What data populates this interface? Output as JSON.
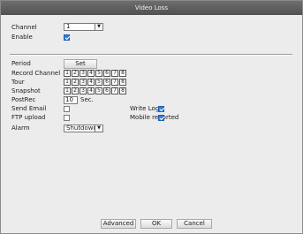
{
  "window": {
    "title": "Video Loss"
  },
  "channel": {
    "label": "Channel",
    "value": "1"
  },
  "enable": {
    "label": "Enable",
    "checked": true
  },
  "period": {
    "label": "Period",
    "button": "Set"
  },
  "record_channel": {
    "label": "Record Channel",
    "channels": [
      "1",
      "2",
      "3",
      "4",
      "5",
      "6",
      "7",
      "8"
    ]
  },
  "tour": {
    "label": "Tour",
    "channels": [
      "1",
      "2",
      "3",
      "4",
      "5",
      "6",
      "7",
      "8"
    ]
  },
  "snapshot": {
    "label": "Snapshot",
    "channels": [
      "1",
      "2",
      "3",
      "4",
      "5",
      "6",
      "7",
      "8"
    ]
  },
  "postrec": {
    "label": "PostRec",
    "value": "10",
    "unit": "Sec."
  },
  "send_email": {
    "label": "Send Email",
    "checked": false
  },
  "write_log": {
    "label": "Write Log",
    "checked": true
  },
  "ftp_upload": {
    "label": "FTP upload",
    "checked": false
  },
  "mobile_reported": {
    "label": "Mobile reported",
    "checked": true
  },
  "alarm": {
    "label": "Alarm",
    "value": "Shutdown"
  },
  "footer": {
    "advanced": "Advanced",
    "ok": "OK",
    "cancel": "Cancel"
  },
  "colors": {
    "titlebar": "#5f5f5f",
    "check_on": "#2f7de1",
    "background": "#ececec"
  }
}
